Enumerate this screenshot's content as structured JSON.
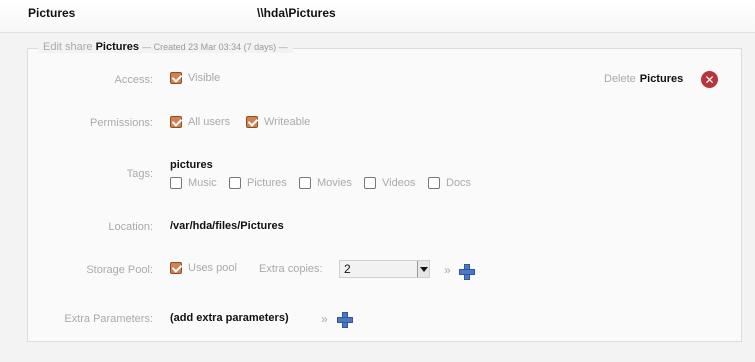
{
  "header": {
    "share_name": "Pictures",
    "share_path": "\\\\hda\\Pictures"
  },
  "form": {
    "legend_prefix": "Edit share",
    "legend_name": "Pictures",
    "legend_meta": "— Created 23 Mar 03:34 (7 days) —",
    "delete_prefix": "Delete",
    "delete_name": "Pictures",
    "access": {
      "label": "Access:",
      "visible_label": "Visible",
      "visible_checked": true
    },
    "permissions": {
      "label": "Permissions:",
      "all_users_label": "All users",
      "all_users_checked": true,
      "writeable_label": "Writeable",
      "writeable_checked": true
    },
    "tags": {
      "label": "Tags:",
      "current": "pictures",
      "options": [
        {
          "label": "Music",
          "checked": false
        },
        {
          "label": "Pictures",
          "checked": false
        },
        {
          "label": "Movies",
          "checked": false
        },
        {
          "label": "Videos",
          "checked": false
        },
        {
          "label": "Docs",
          "checked": false
        }
      ]
    },
    "location": {
      "label": "Location:",
      "value": "/var/hda/files/Pictures"
    },
    "storage_pool": {
      "label": "Storage Pool:",
      "uses_pool_label": "Uses pool",
      "uses_pool_checked": true,
      "extra_copies_label": "Extra copies:",
      "extra_copies_value": "2",
      "raquo": "»"
    },
    "extra_parameters": {
      "label": "Extra Parameters:",
      "value": "(add extra parameters)",
      "raquo": "»"
    }
  },
  "icons": {
    "delete": "close-circle-icon",
    "add": "plus-icon"
  },
  "colors": {
    "checkbox_checked": "#d2824f",
    "delete_red": "#b8343b",
    "add_blue": "#4a78c5"
  }
}
